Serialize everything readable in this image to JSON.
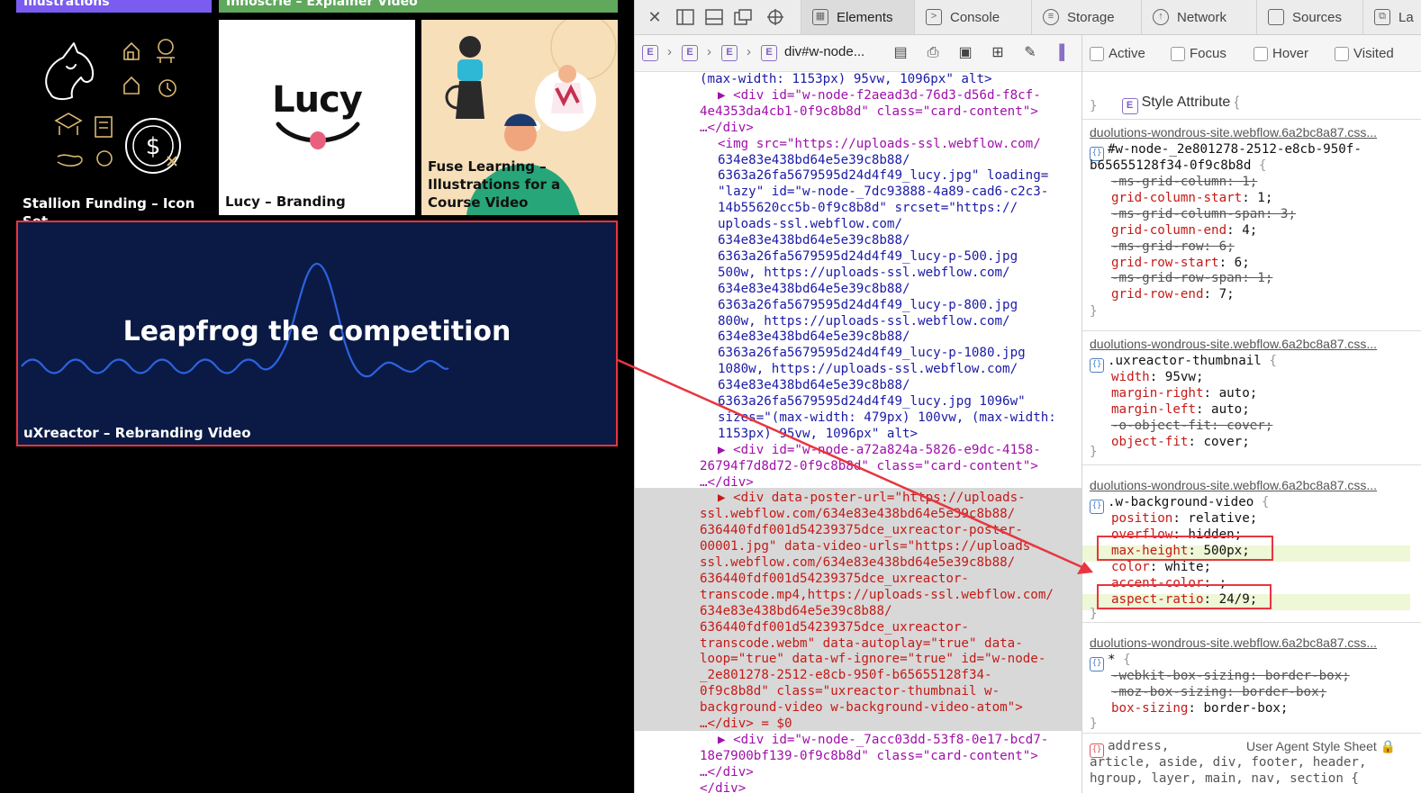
{
  "site": {
    "top_bars": [
      {
        "label": "Illustrations",
        "color": "#7b5cf0"
      },
      {
        "label": "Innoscrie – Explainer Video",
        "color": "#5fa85c"
      }
    ],
    "cards": {
      "stallion": {
        "title": "Stallion Funding – Icon Set"
      },
      "lucy": {
        "title": "Lucy – Branding",
        "logo_text": "Lucy"
      },
      "fuse": {
        "title": "Fuse Learning – Illustrations for a Course Video"
      },
      "uxreactor": {
        "headline": "Leapfrog the competition",
        "title": "uXreactor – Rebranding Video"
      }
    },
    "accent_red": "#e8353f"
  },
  "devtools": {
    "tabs": [
      {
        "label": "Elements",
        "selected": true
      },
      {
        "label": "Console"
      },
      {
        "label": "Storage"
      },
      {
        "label": "Network"
      },
      {
        "label": "Sources"
      },
      {
        "label": "La"
      }
    ],
    "breadcrumb": {
      "element_marker": "E",
      "current": "div#w-node..."
    },
    "pseudo_states": [
      "Active",
      "Focus",
      "Hover",
      "Visited"
    ],
    "dom_lines": [
      {
        "indent": 0,
        "text": "(max-width: 1153px) 95vw, 1096px\" alt>",
        "cls": "c-blue"
      },
      {
        "indent": 1,
        "text": "▶ <div id=\"w-node-f2aead3d-76d3-d56d-f8cf-",
        "cls": "c-purple"
      },
      {
        "indent": 0,
        "text": "4e4353da4cb1-0f9c8b8d\" class=\"card-content\">",
        "cls": "c-purple"
      },
      {
        "indent": 0,
        "text": "…</div>",
        "cls": "c-purple"
      },
      {
        "indent": 1,
        "text": "<img src=\"https://uploads-ssl.webflow.com/",
        "cls": "c-purple"
      },
      {
        "indent": 1,
        "text": "634e83e438bd64e5e39c8b88/",
        "cls": "c-blue"
      },
      {
        "indent": 1,
        "text": "6363a26fa5679595d24d4f49_lucy.jpg\" loading=",
        "cls": "c-blue"
      },
      {
        "indent": 1,
        "text": "\"lazy\" id=\"w-node-_7dc93888-4a89-cad6-c2c3-",
        "cls": "c-blue"
      },
      {
        "indent": 1,
        "text": "14b55620cc5b-0f9c8b8d\" srcset=\"https://",
        "cls": "c-blue"
      },
      {
        "indent": 1,
        "text": "uploads-ssl.webflow.com/",
        "cls": "c-blue"
      },
      {
        "indent": 1,
        "text": "634e83e438bd64e5e39c8b88/",
        "cls": "c-blue"
      },
      {
        "indent": 1,
        "text": "6363a26fa5679595d24d4f49_lucy-p-500.jpg",
        "cls": "c-blue"
      },
      {
        "indent": 1,
        "text": "500w, https://uploads-ssl.webflow.com/",
        "cls": "c-blue"
      },
      {
        "indent": 1,
        "text": "634e83e438bd64e5e39c8b88/",
        "cls": "c-blue"
      },
      {
        "indent": 1,
        "text": "6363a26fa5679595d24d4f49_lucy-p-800.jpg",
        "cls": "c-blue"
      },
      {
        "indent": 1,
        "text": "800w, https://uploads-ssl.webflow.com/",
        "cls": "c-blue"
      },
      {
        "indent": 1,
        "text": "634e83e438bd64e5e39c8b88/",
        "cls": "c-blue"
      },
      {
        "indent": 1,
        "text": "6363a26fa5679595d24d4f49_lucy-p-1080.jpg",
        "cls": "c-blue"
      },
      {
        "indent": 1,
        "text": "1080w, https://uploads-ssl.webflow.com/",
        "cls": "c-blue"
      },
      {
        "indent": 1,
        "text": "634e83e438bd64e5e39c8b88/",
        "cls": "c-blue"
      },
      {
        "indent": 1,
        "text": "6363a26fa5679595d24d4f49_lucy.jpg 1096w\"",
        "cls": "c-blue"
      },
      {
        "indent": 1,
        "text": "sizes=\"(max-width: 479px) 100vw, (max-width:",
        "cls": "c-blue"
      },
      {
        "indent": 1,
        "text": "1153px) 95vw, 1096px\" alt>",
        "cls": "c-blue"
      },
      {
        "indent": 1,
        "text": "▶ <div id=\"w-node-a72a824a-5826-e9dc-4158-",
        "cls": "c-purple"
      },
      {
        "indent": 0,
        "text": "26794f7d8d72-0f9c8b8d\" class=\"card-content\">",
        "cls": "c-purple"
      },
      {
        "indent": 0,
        "text": "…</div>",
        "cls": "c-purple"
      },
      {
        "indent": 1,
        "text": "▶ <div data-poster-url=\"https://uploads-",
        "cls": "c-red"
      },
      {
        "indent": 0,
        "text": "ssl.webflow.com/634e83e438bd64e5e39c8b88/",
        "cls": "c-red"
      },
      {
        "indent": 0,
        "text": "636440fdf001d54239375dce_uxreactor-poster-",
        "cls": "c-red"
      },
      {
        "indent": 0,
        "text": "00001.jpg\" data-video-urls=\"https://uploads-",
        "cls": "c-red"
      },
      {
        "indent": 0,
        "text": "ssl.webflow.com/634e83e438bd64e5e39c8b88/",
        "cls": "c-red"
      },
      {
        "indent": 0,
        "text": "636440fdf001d54239375dce_uxreactor-",
        "cls": "c-red"
      },
      {
        "indent": 0,
        "text": "transcode.mp4,https://uploads-ssl.webflow.com/",
        "cls": "c-red"
      },
      {
        "indent": 0,
        "text": "634e83e438bd64e5e39c8b88/",
        "cls": "c-red"
      },
      {
        "indent": 0,
        "text": "636440fdf001d54239375dce_uxreactor-",
        "cls": "c-red"
      },
      {
        "indent": 0,
        "text": "transcode.webm\" data-autoplay=\"true\" data-",
        "cls": "c-red"
      },
      {
        "indent": 0,
        "text": "loop=\"true\" data-wf-ignore=\"true\" id=\"w-node-",
        "cls": "c-red"
      },
      {
        "indent": 0,
        "text": "_2e801278-2512-e8cb-950f-b65655128f34-",
        "cls": "c-red"
      },
      {
        "indent": 0,
        "text": "0f9c8b8d\" class=\"uxreactor-thumbnail w-",
        "cls": "c-red"
      },
      {
        "indent": 0,
        "text": "background-video w-background-video-atom\">",
        "cls": "c-red"
      },
      {
        "indent": 0,
        "text": "…</div> = $0",
        "cls": "c-red"
      },
      {
        "indent": 1,
        "text": "▶ <div id=\"w-node-_7acc03dd-53f8-0e17-bcd7-",
        "cls": "c-purple"
      },
      {
        "indent": 0,
        "text": "18e7900bf139-0f9c8b8d\" class=\"card-content\">",
        "cls": "c-purple"
      },
      {
        "indent": 0,
        "text": "…</div>",
        "cls": "c-purple"
      },
      {
        "indent": 0,
        "text": "</div>",
        "cls": "c-purple"
      }
    ],
    "styles": {
      "style_attribute": {
        "label": "Style Attribute",
        "brace_open": "{",
        "brace_close": "}"
      },
      "source": "duolutions-wondrous-site.webflow.6a2bc8a87.css...",
      "rule1": {
        "selector_l1": "#w-node-_2e801278-2512-e8cb-950f-",
        "selector_l2": "b65655128f34-0f9c8b8d",
        "lines": [
          {
            "text": "-ms-grid-column: 1;",
            "struck": true
          },
          {
            "text": "grid-column-start: 1;",
            "struck": false
          },
          {
            "text": "-ms-grid-column-span: 3;",
            "struck": true
          },
          {
            "text": "grid-column-end: 4;",
            "struck": false
          },
          {
            "text": "-ms-grid-row: 6;",
            "struck": true
          },
          {
            "text": "grid-row-start: 6;",
            "struck": false
          },
          {
            "text": "-ms-grid-row-span: 1;",
            "struck": true
          },
          {
            "text": "grid-row-end: 7;",
            "struck": false
          }
        ]
      },
      "rule2": {
        "selector": ".uxreactor-thumbnail",
        "lines": [
          {
            "text": "width: 95vw;",
            "struck": false
          },
          {
            "text": "margin-right: auto;",
            "struck": false
          },
          {
            "text": "margin-left: auto;",
            "struck": false
          },
          {
            "text": "-o-object-fit: cover;",
            "struck": true
          },
          {
            "text": "object-fit: cover;",
            "struck": false
          }
        ]
      },
      "rule3": {
        "selector": ".w-background-video",
        "lines": [
          {
            "text": "position: relative;",
            "struck": false
          },
          {
            "text": "overflow: hidden;",
            "struck": false
          },
          {
            "text": "max-height: 500px;",
            "struck": false
          },
          {
            "text": "color: white;",
            "struck": false
          },
          {
            "text": "accent-color: ;",
            "struck": false
          },
          {
            "text": "aspect-ratio: 24/9;",
            "struck": false
          }
        ]
      },
      "rule4": {
        "selector": "*",
        "lines": [
          {
            "text": "-webkit-box-sizing: border-box;",
            "struck": true
          },
          {
            "text": "-moz-box-sizing: border-box;",
            "struck": true
          },
          {
            "text": "box-sizing: border-box;",
            "struck": false
          }
        ]
      },
      "ua_rule": {
        "label": "User Agent Style Sheet",
        "l1": "address,",
        "l2": "article, aside, div, footer, header,",
        "l3": "hgroup, layer, main, nav, section {"
      }
    }
  }
}
